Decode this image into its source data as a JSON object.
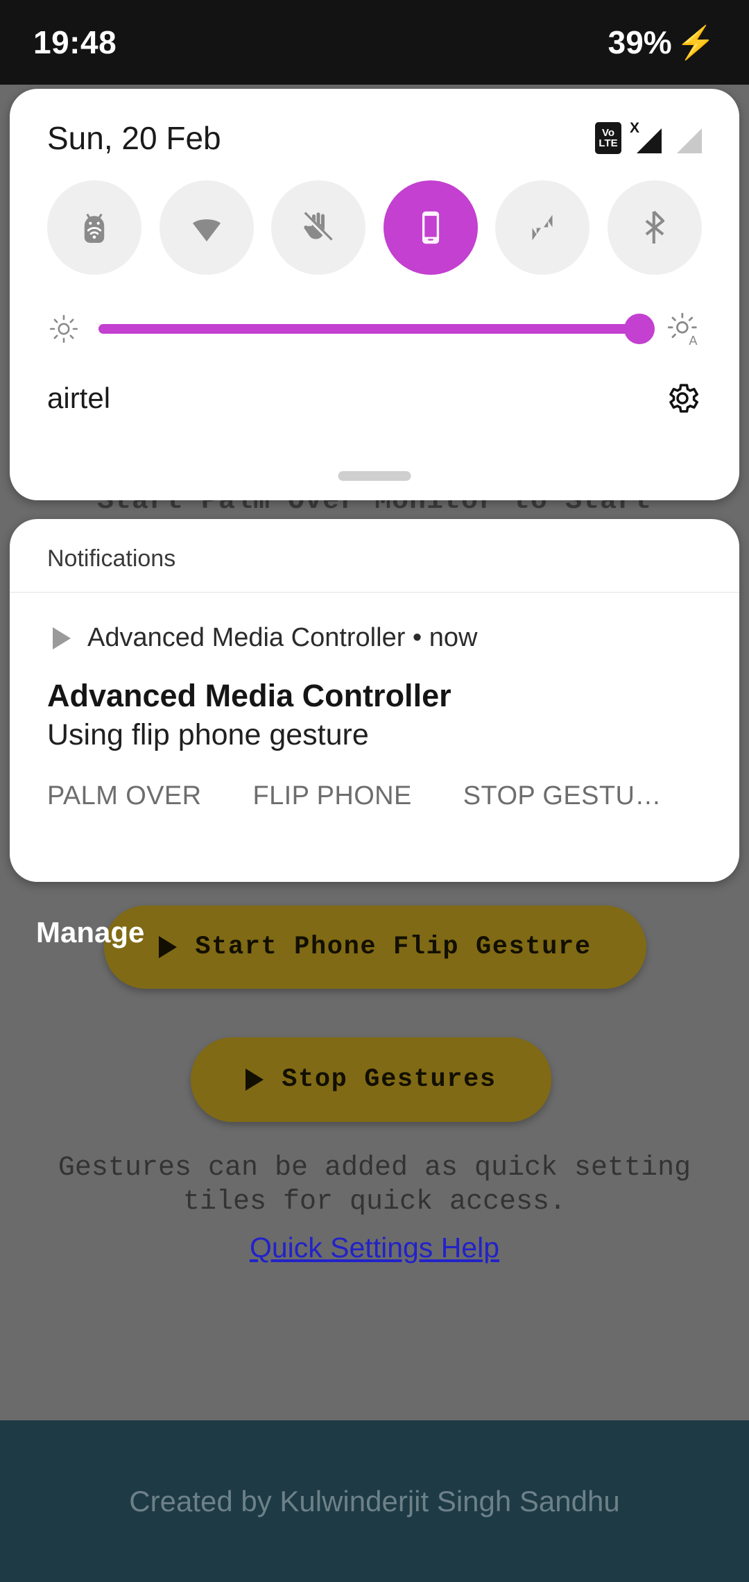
{
  "status_bar": {
    "time": "19:48",
    "battery": "39%",
    "charging_icon": "bolt-icon"
  },
  "quick_settings": {
    "date": "Sun, 20 Feb",
    "status_icons": {
      "volte_top": "Vo",
      "volte_bottom": "LTE",
      "signal_x": "X"
    },
    "tiles": [
      {
        "name": "android-share-tile",
        "icon": "android-wifi-icon",
        "active": false
      },
      {
        "name": "wifi-tile",
        "icon": "wifi-icon",
        "active": false
      },
      {
        "name": "palm-over-tile",
        "icon": "hand-slash-icon",
        "active": false
      },
      {
        "name": "phone-flip-tile",
        "icon": "phone-icon",
        "active": true
      },
      {
        "name": "data-transfer-tile",
        "icon": "data-arrows-icon",
        "active": false
      },
      {
        "name": "bluetooth-tile",
        "icon": "bluetooth-icon",
        "active": false
      }
    ],
    "brightness": {
      "low_icon": "brightness-low-icon",
      "auto_icon": "brightness-auto-icon",
      "value": 100
    },
    "carrier": "airtel",
    "settings_icon": "gear-icon"
  },
  "notifications": {
    "header": "Notifications",
    "items": [
      {
        "app": "Advanced Media Controller • now",
        "title": "Advanced Media Controller",
        "text": "Using flip phone gesture",
        "actions": [
          "PALM OVER",
          "FLIP PHONE",
          "STOP GESTU…"
        ]
      }
    ],
    "manage_label": "Manage"
  },
  "app": {
    "partial_text": "Start Palm Over Monitor to Start",
    "buttons": [
      {
        "name": "start-phone-flip-gesture-button",
        "label": "Start Phone Flip Gesture"
      },
      {
        "name": "stop-gestures-button",
        "label": "Stop Gestures"
      }
    ],
    "description_line1": "Gestures can be added as quick setting",
    "description_line2": "tiles for quick access.",
    "help_link": "Quick Settings Help",
    "footer": "Created by Kulwinderjit Singh Sandhu"
  },
  "colors": {
    "accent": "#c340d0",
    "button_gold": "#806a15",
    "footer_bg": "#1e3a45",
    "scrim": "#6b6b6b",
    "status_bar_bg": "#131313"
  }
}
